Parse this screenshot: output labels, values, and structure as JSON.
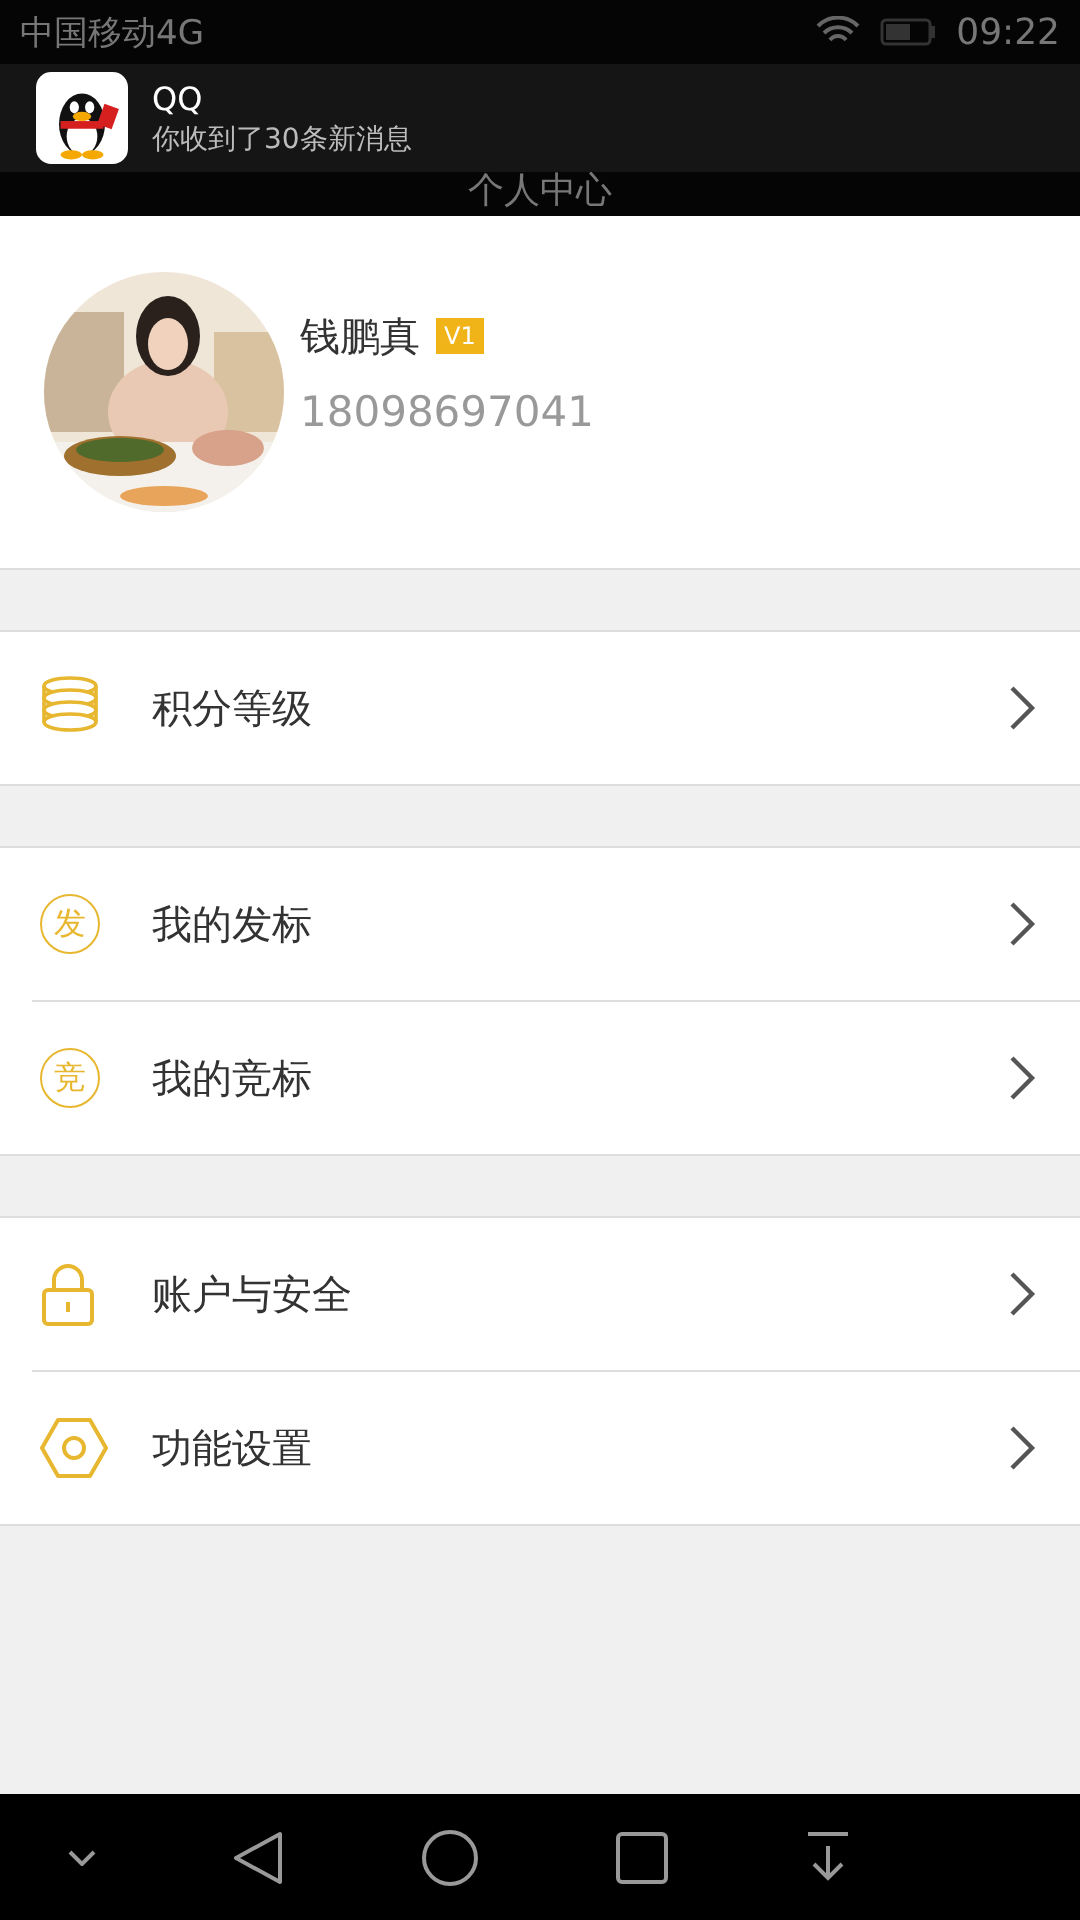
{
  "status_bar": {
    "carrier": "中国移动4G",
    "time": "09:22"
  },
  "notification": {
    "app": "QQ",
    "message": "你收到了30条新消息"
  },
  "header": {
    "title": "个人中心"
  },
  "profile": {
    "name": "钱鹏真",
    "badge": "V1",
    "phone": "18098697041"
  },
  "menu_groups": [
    [
      {
        "kind": "coins",
        "label": "积分等级"
      }
    ],
    [
      {
        "kind": "char",
        "glyph": "发",
        "label": "我的发标"
      },
      {
        "kind": "char",
        "glyph": "竞",
        "label": "我的竞标"
      }
    ],
    [
      {
        "kind": "lock",
        "label": "账户与安全"
      },
      {
        "kind": "gear",
        "label": "功能设置"
      }
    ]
  ]
}
